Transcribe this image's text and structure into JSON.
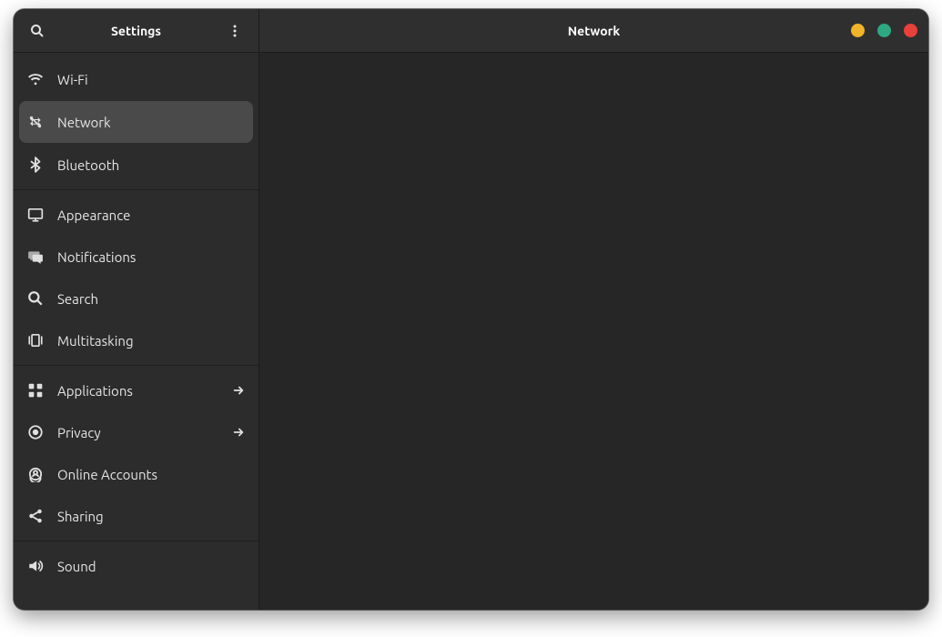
{
  "titlebar": {
    "sidebar_title": "Settings",
    "page_title": "Network"
  },
  "sidebar": {
    "groups": [
      [
        {
          "icon": "wifi",
          "label": "Wi-Fi",
          "selected": false,
          "has_chevron": false
        },
        {
          "icon": "network",
          "label": "Network",
          "selected": true,
          "has_chevron": false
        },
        {
          "icon": "bluetooth",
          "label": "Bluetooth",
          "selected": false,
          "has_chevron": false
        }
      ],
      [
        {
          "icon": "appearance",
          "label": "Appearance",
          "selected": false,
          "has_chevron": false
        },
        {
          "icon": "notifications",
          "label": "Notifications",
          "selected": false,
          "has_chevron": false
        },
        {
          "icon": "search",
          "label": "Search",
          "selected": false,
          "has_chevron": false
        },
        {
          "icon": "multitasking",
          "label": "Multitasking",
          "selected": false,
          "has_chevron": false
        }
      ],
      [
        {
          "icon": "applications",
          "label": "Applications",
          "selected": false,
          "has_chevron": true
        },
        {
          "icon": "privacy",
          "label": "Privacy",
          "selected": false,
          "has_chevron": true
        },
        {
          "icon": "online-accounts",
          "label": "Online Accounts",
          "selected": false,
          "has_chevron": false
        },
        {
          "icon": "sharing",
          "label": "Sharing",
          "selected": false,
          "has_chevron": false
        }
      ],
      [
        {
          "icon": "sound",
          "label": "Sound",
          "selected": false,
          "has_chevron": false
        }
      ]
    ]
  }
}
